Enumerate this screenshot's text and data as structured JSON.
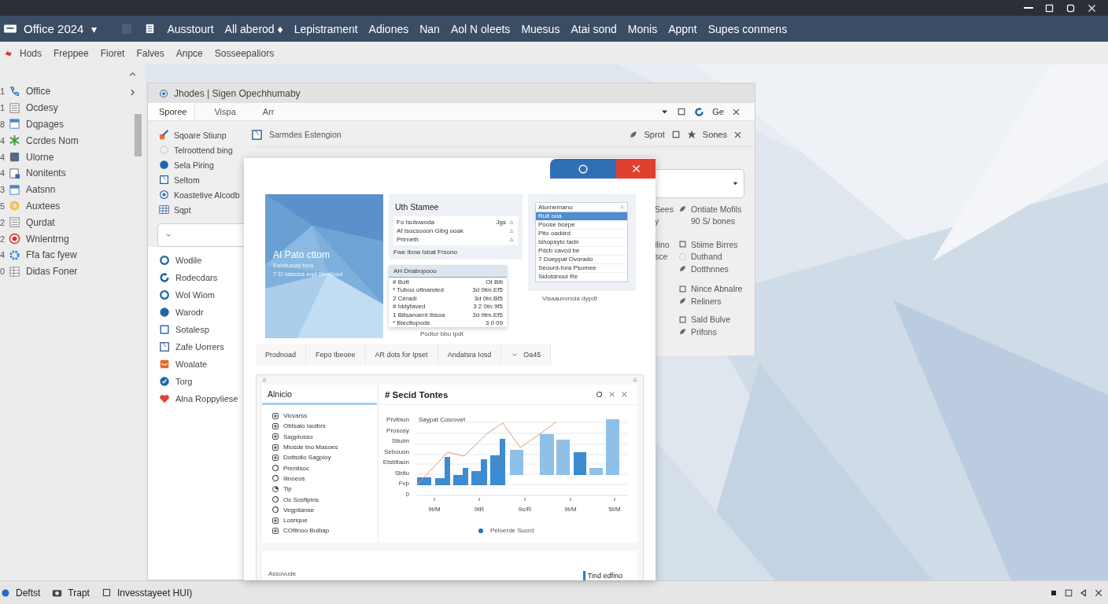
{
  "app": {
    "title": "Office 2024",
    "caret": "▾"
  },
  "menu": [
    "Ausstourt",
    "All aberod ♦",
    "Lepistrament",
    "Adiones",
    "Nan",
    "Aol N oleets",
    "Muesus",
    "Atai sond",
    "Monis",
    "Appnt",
    "Supes conmens"
  ],
  "toolbar": [
    "Hods",
    "Freppee",
    "Fioret",
    "Falves",
    "Anpce",
    "Sosseepaliors"
  ],
  "sidebar": {
    "items": [
      {
        "number": "1",
        "label": "Office"
      },
      {
        "number": "1",
        "label": "Ocdesy"
      },
      {
        "number": "8",
        "label": "Dqpages"
      },
      {
        "number": "4",
        "label": "Ccrdes Nom"
      },
      {
        "number": "4",
        "label": "Ulorne"
      },
      {
        "number": "4",
        "label": "Nonitents"
      },
      {
        "number": "3",
        "label": "Aatsnn"
      },
      {
        "number": "5",
        "label": "Auxtees"
      },
      {
        "number": "2",
        "label": "Qurdat"
      },
      {
        "number": "2",
        "label": "Wnlentrng"
      },
      {
        "number": "4",
        "label": "Ffa fac fyew"
      },
      {
        "number": "0",
        "label": "Didas Foner"
      }
    ]
  },
  "window": {
    "title": "Jhodes | Sigen Opechhumaby",
    "tabs": [
      {
        "label": "Sporee",
        "selected": true
      },
      {
        "label": "Vispa",
        "selected": false
      },
      {
        "label": "Arr",
        "selected": false
      }
    ],
    "tab_tail": "Ge",
    "tools": [
      "Sqoare Stiunp",
      "Telroottend bing",
      "Sela Piring",
      "Seltom",
      "Koastetive Alcodb",
      "Sqpt"
    ],
    "items": [
      "Wodile",
      "Rodecdars",
      "Wol Wiom",
      "Warodr",
      "Sotalesp",
      "Zafe Uorrers",
      "Woalate",
      "Torg",
      "Alna Roppyliese"
    ],
    "header": "Sarmdes Estengion",
    "header_actions": [
      "Sprot",
      "Sones"
    ],
    "side_groups": [
      [
        {
          "cut": "Sees",
          "label": "Ontiate Mofils"
        },
        {
          "cut": "y",
          "label": "90 S/ bones"
        }
      ],
      [
        {
          "cut": "llino",
          "label": "Stiime Birres"
        },
        {
          "cut": "sce",
          "label": "Duthand"
        },
        {
          "label": "Dotthnnes"
        }
      ],
      [
        {
          "label": "Nince Abnalre"
        },
        {
          "label": "Reliners"
        }
      ],
      [
        {
          "label": "Sald Bulve"
        },
        {
          "label": "Prifons"
        }
      ]
    ]
  },
  "dialog": {
    "cover": {
      "kind": "picture",
      "title": "AI Pato cttom",
      "line_1": "Eshitunas tora",
      "line_2": "7 D Ialsosa eqd titenbool"
    },
    "info_card": {
      "title": "Uth Stamee",
      "rows": [
        {
          "label": "Fo Isutuwoda",
          "value": "Jgs"
        },
        {
          "label": "Af Isocsooon Gibg ooak"
        },
        {
          "label": "Prirneth"
        }
      ],
      "footer": "Fwe Ibow Isbat Frsono"
    },
    "table_card": {
      "title": "AH Dnabopooo",
      "header": [
        "# Bott",
        "Ot Biti"
      ],
      "rows": [
        [
          "* Tuboo ofinanded",
          "3d 0tm.Ef5"
        ],
        [
          "2 Ceradi",
          "3d 0tn.Bf5"
        ],
        [
          "# Iddyfaved",
          "3 2 0tn.9f5"
        ],
        [
          "1 Bitsanoent Ibsoa",
          "3d 9tm.Ef5"
        ],
        [
          "* Blecttopode",
          "3 0 09"
        ]
      ],
      "caption": "Podtor bbu Ipdt"
    },
    "list_card": {
      "header": "Aturnemano",
      "items": [
        {
          "label": "Rult ooa",
          "selected": true
        },
        {
          "label": "Poose bcepe",
          "selected": false
        },
        {
          "label": "Pito oaddrd",
          "selected": false
        },
        {
          "label": "Ishopsylo tadn",
          "selected": false
        },
        {
          "label": "Pdcb cavcd be",
          "selected": false
        },
        {
          "label": "7 Doeppal Ovorado",
          "selected": false
        },
        {
          "label": "Seourd-fora Psomee",
          "selected": false
        },
        {
          "label": "Sidotdnoul Re",
          "selected": false
        }
      ],
      "caption": "Visaaunvnola dypdt"
    },
    "tabs": [
      "Prodnoad",
      "Fepo Ibeoee",
      "AR dots for Ipset",
      "Andatsra Iosd",
      "Oa45"
    ],
    "list": {
      "title": "Alnicio",
      "items": [
        {
          "label": "Vlcvarss",
          "kind": "box"
        },
        {
          "label": "Obtsalo Iaulbrs",
          "kind": "box"
        },
        {
          "label": "Sagplusso",
          "kind": "box"
        },
        {
          "label": "Mlosde tno Masoes",
          "kind": "box"
        },
        {
          "label": "Dottsdio Sagpioy",
          "kind": "box"
        },
        {
          "label": "Prenlisoc",
          "kind": "ring"
        },
        {
          "label": "Ilinoeos",
          "kind": "ring"
        },
        {
          "label": "Tip",
          "kind": "pie"
        },
        {
          "label": "Oc Sosfipins",
          "kind": "ring"
        },
        {
          "label": "Vegplianse",
          "kind": "ring"
        },
        {
          "label": "Losrique",
          "kind": "box"
        },
        {
          "label": "COfilnoo Buibap",
          "kind": "box"
        }
      ]
    },
    "chart": {
      "title": "# Secid Tontes",
      "inner_label": "Saypat Cosrovet",
      "y_labels": [
        "Prvibiun",
        "Prososy",
        "Stiuim",
        "Sebouon",
        "Etsbtlaon",
        "Sbitu",
        "Fvp",
        "0"
      ],
      "x_labels": [
        "9t/M",
        "9tR",
        "9c/R",
        "9t/M",
        "5t/M"
      ],
      "legend": "Peloerde Sucrd"
    },
    "footer": {
      "label": "Assovude",
      "button": "Tind edfino"
    }
  },
  "taskbar": [
    "Deftst",
    "Trapt",
    "Invesstayeet HUI)"
  ]
}
